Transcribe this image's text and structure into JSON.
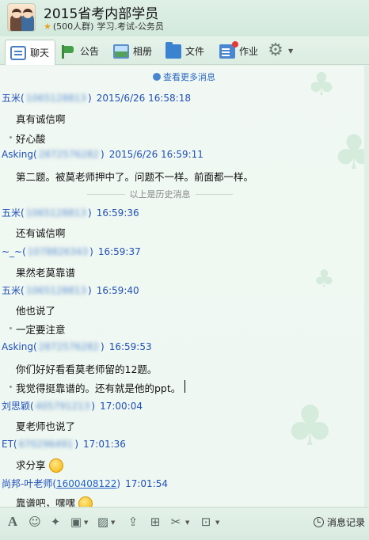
{
  "header": {
    "title": "2015省考内部学员",
    "member_count": "(500人群)",
    "category": "学习.考试-公务员"
  },
  "tabs": [
    {
      "label": "聊天",
      "icon": "chat-icon"
    },
    {
      "label": "公告",
      "icon": "notice-icon"
    },
    {
      "label": "相册",
      "icon": "album-icon"
    },
    {
      "label": "文件",
      "icon": "folder-icon"
    },
    {
      "label": "作业",
      "icon": "homework-icon"
    }
  ],
  "chat": {
    "view_more": "查看更多消息",
    "history_divider": "以上是历史消息",
    "messages": [
      {
        "name": "五米(",
        "uid": "1065128813",
        "close": ")",
        "time": "2015/6/26 16:58:18"
      },
      {
        "text": "真有诚信啊"
      },
      {
        "text": "好心酸"
      },
      {
        "name": "Asking(",
        "uid": "2872576282",
        "close": ")",
        "time": "2015/6/26 16:59:11"
      },
      {
        "text": "第二题。被莫老师押中了。问题不一样。前面都一样。"
      },
      {
        "name": "五米(",
        "uid": "1065128813",
        "close": ")",
        "time": "16:59:36"
      },
      {
        "text": "还有诚信啊"
      },
      {
        "name": "~_~(",
        "uid": "1078826343",
        "close": ")",
        "time": "16:59:37"
      },
      {
        "text": "果然老莫靠谱"
      },
      {
        "name": "五米(",
        "uid": "1065128813",
        "close": ")",
        "time": "16:59:40"
      },
      {
        "text": "他也说了"
      },
      {
        "text": "一定要注意"
      },
      {
        "name": "Asking(",
        "uid": "2872576282",
        "close": ")",
        "time": "16:59:53"
      },
      {
        "text": "你们好好看看莫老师留的12题。"
      },
      {
        "text": "我觉得挺靠谱的。还有就是他的ppt。"
      },
      {
        "name": "刘思颖(",
        "uid": "405791213",
        "close": ")",
        "time": "17:00:04"
      },
      {
        "text": "夏老师也说了"
      },
      {
        "name": "ET(",
        "uid": "670296491",
        "close": ")",
        "time": "17:01:36"
      },
      {
        "text": "求分享"
      },
      {
        "name": "尚邦-叶老师(",
        "uid": "1600408122",
        "close": ")",
        "time": "17:01:54"
      },
      {
        "text": "靠谱吧，嘿嘿"
      }
    ]
  },
  "toolbar": {
    "history_label": "消息记录"
  }
}
